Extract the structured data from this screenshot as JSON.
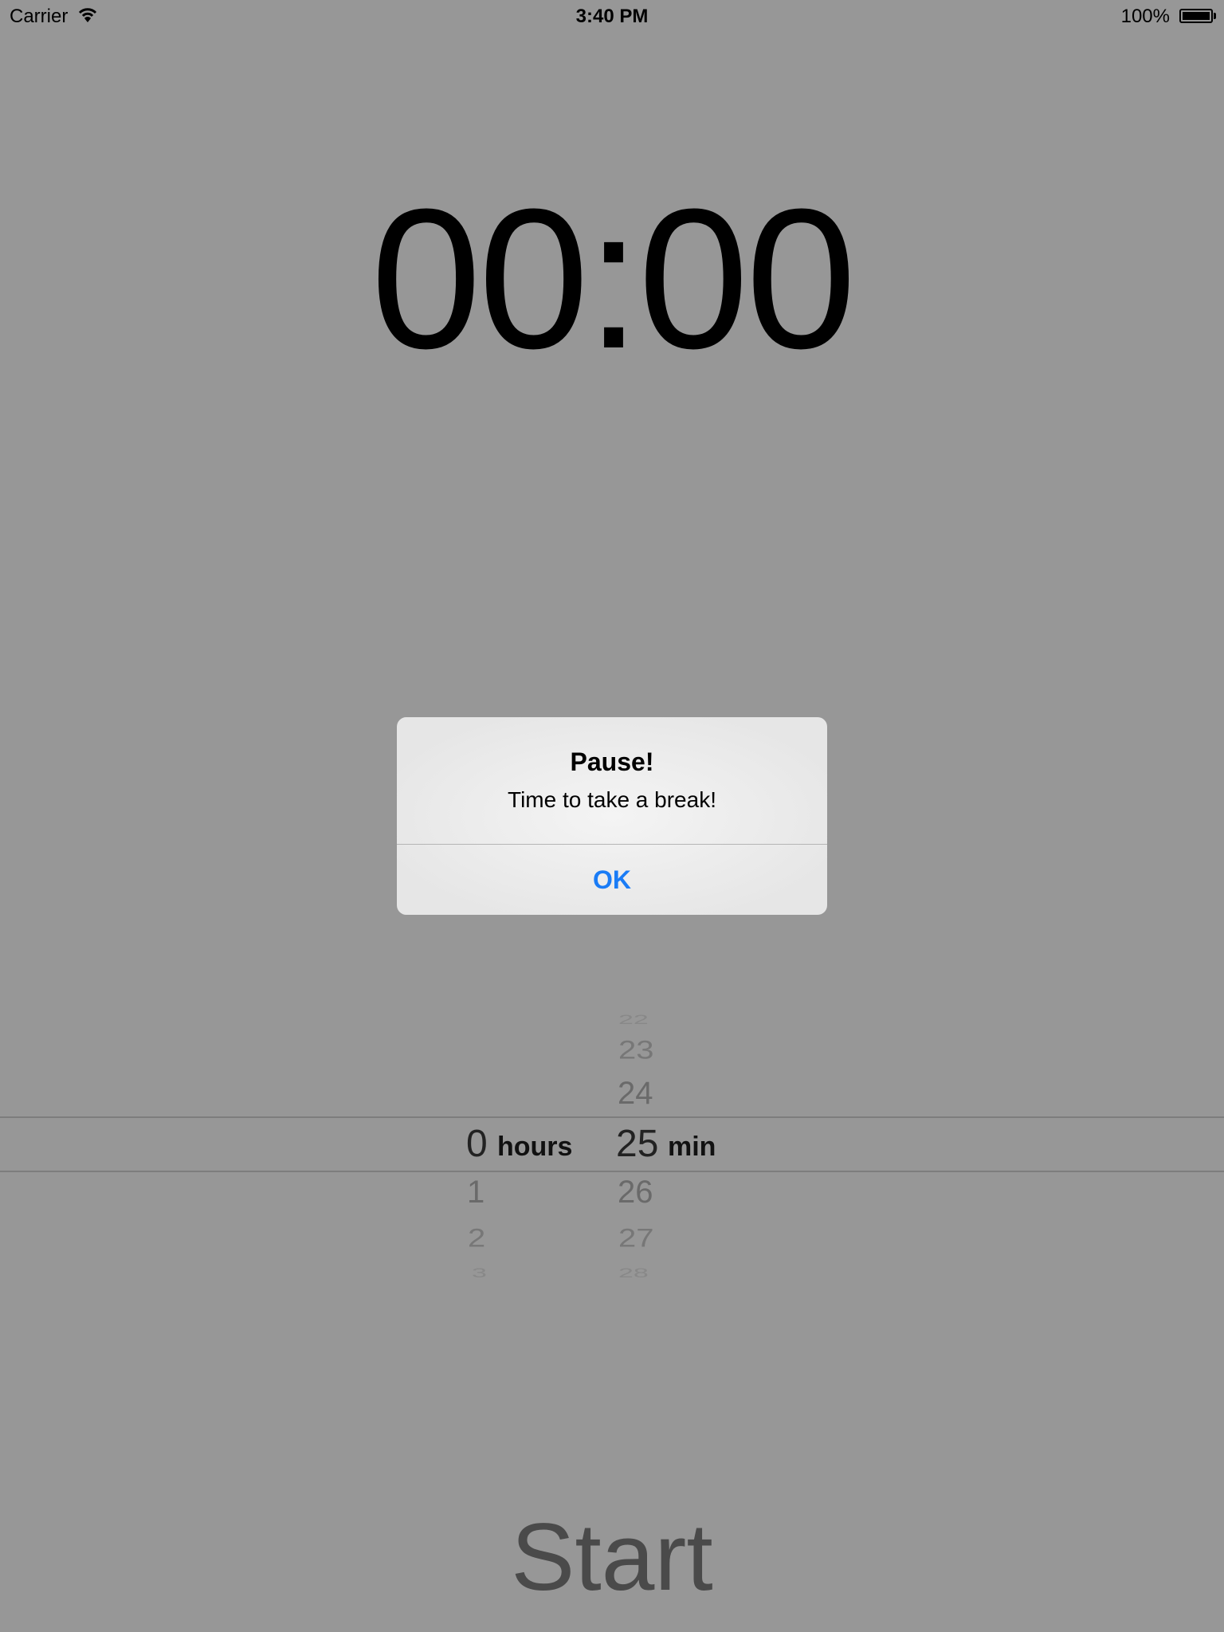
{
  "status_bar": {
    "carrier": "Carrier",
    "time": "3:40 PM",
    "battery": "100%",
    "battery_level": 1.0
  },
  "timer": {
    "display": "00:00"
  },
  "alert": {
    "title": "Pause!",
    "message": "Time to take a break!",
    "ok_label": "OK"
  },
  "picker": {
    "hours": {
      "selected": "0",
      "unit": "hours",
      "after": [
        "1",
        "2",
        "3"
      ]
    },
    "minutes": {
      "before": [
        "22",
        "23",
        "24"
      ],
      "selected": "25",
      "unit": "min",
      "after": [
        "26",
        "27",
        "28"
      ]
    }
  },
  "start_label": "Start"
}
